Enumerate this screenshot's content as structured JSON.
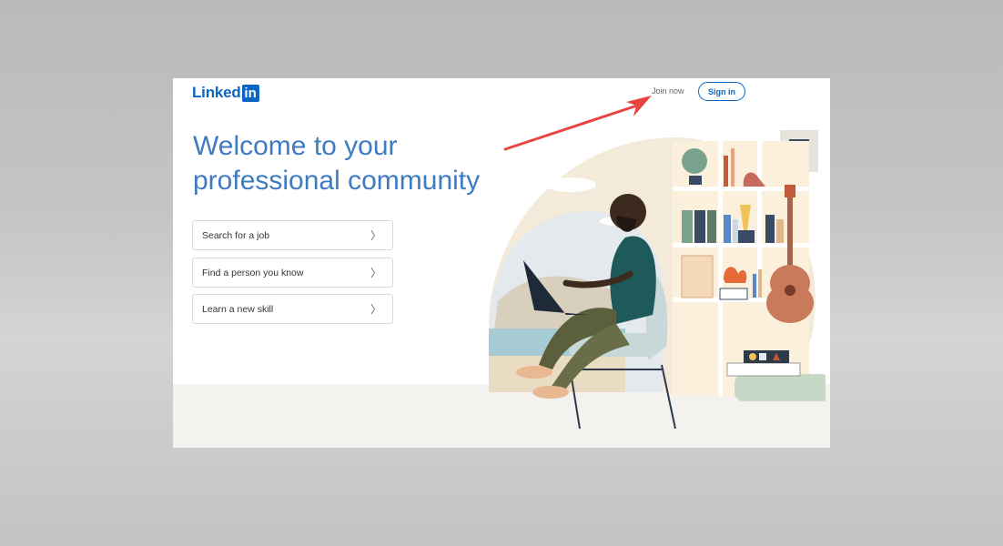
{
  "header": {
    "logo_text": "Linked",
    "logo_box": "in",
    "join_label": "Join now",
    "signin_label": "Sign in"
  },
  "hero": {
    "headline_line1": "Welcome to your",
    "headline_line2": "professional community"
  },
  "options": [
    {
      "label": "Search for a job",
      "chevron": "〉"
    },
    {
      "label": "Find a person you know",
      "chevron": "〉"
    },
    {
      "label": "Learn a new skill",
      "chevron": "〉"
    }
  ],
  "colors": {
    "brand": "#0a66c2",
    "headline": "#3f7bc0",
    "arrow": "#e8453f"
  },
  "annotation": {
    "icon": "red-arrow-icon"
  }
}
